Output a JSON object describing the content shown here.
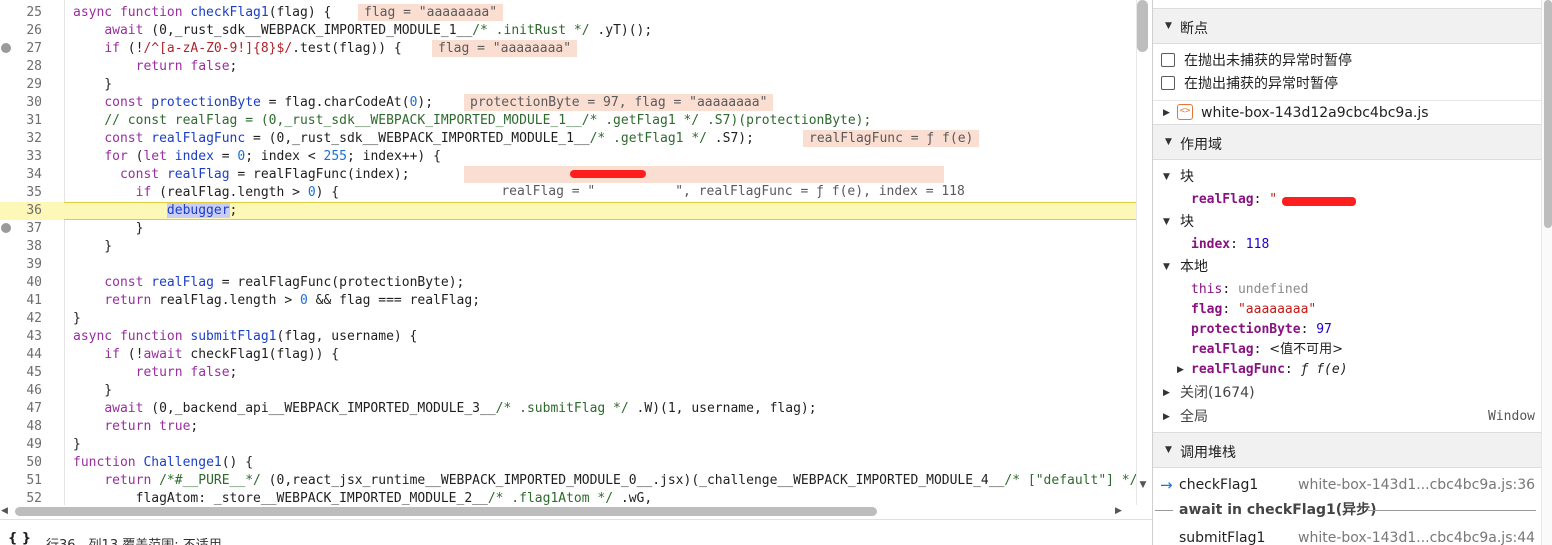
{
  "code_lines": [
    {
      "n": "25",
      "html": "<span class=\"kw\">async function</span> <span class=\"fn\">checkFlag1</span>(flag) {"
    },
    {
      "n": "26",
      "html": "    <span class=\"kw\">await</span> (0,_rust_sdk__WEBPACK_IMPORTED_MODULE_1__<span class=\"cm\">/* .initRust */</span> .yT)();"
    },
    {
      "n": "27",
      "html": "    <span class=\"kw\">if</span> (!<span class=\"re\">/^[a-zA-Z0-9!]{8}$/</span>.test(flag)) {"
    },
    {
      "n": "28",
      "html": "        <span class=\"kw\">return false</span>;"
    },
    {
      "n": "29",
      "html": "    }"
    },
    {
      "n": "30",
      "html": "    <span class=\"kw\">const</span> <span class=\"fn\">protectionByte</span> = flag.charCodeAt(<span class=\"num\">0</span>);"
    },
    {
      "n": "31",
      "html": "    <span class=\"cm\">// const realFlag = (0,_rust_sdk__WEBPACK_IMPORTED_MODULE_1__/* .getFlag1 */ .S7)(protectionByte);</span>"
    },
    {
      "n": "32",
      "html": "    <span class=\"kw\">const</span> <span class=\"fn\">realFlagFunc</span> = (0,_rust_sdk__WEBPACK_IMPORTED_MODULE_1__<span class=\"cm\">/* .getFlag1 */</span> .S7);"
    },
    {
      "n": "33",
      "html": "    <span class=\"kw\">for</span> (<span class=\"kw\">let</span> <span class=\"fn\">index</span> = <span class=\"num\">0</span>; index &lt; <span class=\"num\">255</span>; index++) {"
    },
    {
      "n": "34",
      "html": "      <span class=\"kw\">const</span> <span class=\"fn\">realFlag</span> = realFlagFunc(index);"
    },
    {
      "n": "35",
      "html": "        <span class=\"kw\">if</span> (realFlag.length &gt; <span class=\"num\">0</span>) {"
    },
    {
      "n": "36",
      "html": "            <span class=\"hl-token\">debugger</span>;"
    },
    {
      "n": "37",
      "html": "        }"
    },
    {
      "n": "38",
      "html": "    }"
    },
    {
      "n": "39",
      "html": ""
    },
    {
      "n": "40",
      "html": "    <span class=\"kw\">const</span> <span class=\"fn\">realFlag</span> = realFlagFunc(protectionByte);"
    },
    {
      "n": "41",
      "html": "    <span class=\"kw\">return</span> realFlag.length &gt; <span class=\"num\">0</span> &amp;&amp; flag === realFlag;"
    },
    {
      "n": "42",
      "html": "}"
    },
    {
      "n": "43",
      "html": "<span class=\"kw\">async function</span> <span class=\"fn\">submitFlag1</span>(flag, username) {"
    },
    {
      "n": "44",
      "html": "    <span class=\"kw\">if</span> (!<span class=\"kw\">await</span> checkFlag1(flag)) {"
    },
    {
      "n": "45",
      "html": "        <span class=\"kw\">return false</span>;"
    },
    {
      "n": "46",
      "html": "    }"
    },
    {
      "n": "47",
      "html": "    <span class=\"kw\">await</span> (0,_backend_api__WEBPACK_IMPORTED_MODULE_3__<span class=\"cm\">/* .submitFlag */</span> .W)(1, username, flag);"
    },
    {
      "n": "48",
      "html": "    <span class=\"kw\">return true</span>;"
    },
    {
      "n": "49",
      "html": "}"
    },
    {
      "n": "50",
      "html": "<span class=\"kw\">function</span> <span class=\"fn\">Challenge1</span>() {"
    },
    {
      "n": "51",
      "html": "    <span class=\"kw\">return</span> <span class=\"cm\">/*#__PURE__*/</span> (0,react_jsx_runtime__WEBPACK_IMPORTED_MODULE_0__.jsx)(_challenge__WEBPACK_IMPORTED_MODULE_4__<span class=\"cm\">/* [\"default\"] */</span>"
    },
    {
      "n": "52",
      "html": "        flagAtom: _store__WEBPACK_IMPORTED_MODULE_2__<span class=\"cm\">/* .flag1Atom */</span> .wG,"
    }
  ],
  "inline_values": {
    "line25": "flag = \"aaaaaaaa\"",
    "line27": "flag = \"aaaaaaaa\"",
    "line30": "protectionByte = 97, flag = \"aaaaaaaa\"",
    "line32": "realFlagFunc = ƒ f(e)",
    "line34_prefix": "realFlag = \"",
    "line34_suffix": "\", realFlagFunc = ƒ f(e), index = 118"
  },
  "status_bar": {
    "braces": "{ }",
    "position": "行36，列13   覆盖范围: 不适用"
  },
  "sidebar": {
    "breakpoints": {
      "title": "断点",
      "pause_uncaught": "在抛出未捕获的异常时暂停",
      "pause_caught": "在抛出捕获的异常时暂停",
      "file": "white-box-143d12a9cbc4bc9a.js"
    },
    "scope": {
      "title": "作用域",
      "block1": "块",
      "block1_var_key": "realFlag",
      "block1_var_quote": "\"",
      "block2": "块",
      "block2_var_key": "index",
      "block2_var_val": "118",
      "local": "本地",
      "this_key": "this",
      "this_val": "undefined",
      "flag_key": "flag",
      "flag_val": "\"aaaaaaaa\"",
      "pb_key": "protectionByte",
      "pb_val": "97",
      "rf_key": "realFlag",
      "rf_val": "<值不可用>",
      "rff_key": "realFlagFunc",
      "rff_val": "ƒ f(e)",
      "closure": "关闭(1674)",
      "global": "全局",
      "global_val": "Window"
    },
    "callstack": {
      "title": "调用堆栈",
      "frame1_name": "checkFlag1",
      "frame1_loc": "white-box-143d1...cbc4bc9a.js:36",
      "async_sep": "await in checkFlag1(异步)",
      "frame2_name": "submitFlag1",
      "frame2_loc": "white-box-143d1...cbc4bc9a.js:44"
    }
  },
  "colors": {
    "paused_line": "#fdf8b8",
    "inline_value_bg": "#fbded2",
    "redaction": "#ff1e1e",
    "keyword": "#9a2ea0",
    "identifier": "#1b3ec8"
  }
}
